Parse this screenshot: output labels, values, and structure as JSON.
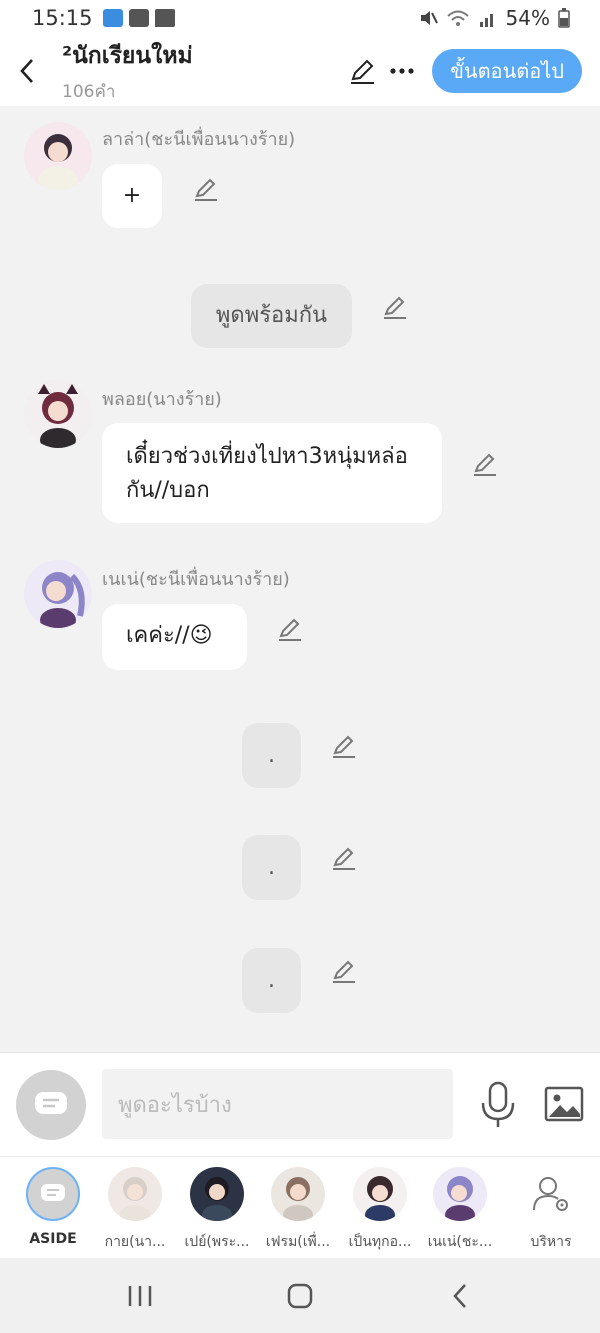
{
  "status_bar": {
    "time": "15:15",
    "battery": "54%"
  },
  "header": {
    "title": "²นักเรียนใหม่",
    "word_count": "106คำ",
    "next_button": "ขั้นตอนต่อไป"
  },
  "messages": [
    {
      "sender": "ลาล่า(ชะนีเพื่อนนางร้าย)",
      "text": "+"
    },
    {
      "sender": "",
      "text": "พูดพร้อมกัน"
    },
    {
      "sender": "พลอย(นางร้าย)",
      "text": "เดี๋ยวช่วงเที่ยงไปหา3หนุ่มหล่อกัน//บอก"
    },
    {
      "sender": "เนเน่(ชะนีเพื่อนนางร้าย)",
      "text": "เคค่ะ//😉"
    },
    {
      "sender": "",
      "text": "."
    },
    {
      "sender": "",
      "text": "."
    },
    {
      "sender": "",
      "text": "."
    }
  ],
  "input": {
    "placeholder": "พูดอะไรบ้าง"
  },
  "characters": [
    {
      "label": "ASIDE"
    },
    {
      "label": "กาย(นา..."
    },
    {
      "label": "เปย์(พระ..."
    },
    {
      "label": "เฟรม(เพื่..."
    },
    {
      "label": "เป็นทุกอ..."
    },
    {
      "label": "เนเน่(ชะ..."
    },
    {
      "label": "บริหาร"
    }
  ],
  "colors": {
    "accent": "#5aa9f6",
    "background": "#f2f2f2"
  }
}
